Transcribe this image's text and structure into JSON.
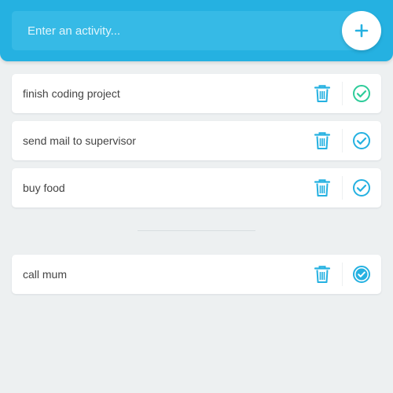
{
  "header": {
    "input": {
      "placeholder": "Enter an activity...",
      "value": ""
    },
    "add_button_icon": "plus-icon"
  },
  "todo_list": [
    {
      "text": "finish coding project",
      "status": "pending",
      "check_color": "#2ecc9a"
    },
    {
      "text": "send mail to supervisor",
      "status": "pending",
      "check_color": "#25b1e1"
    },
    {
      "text": "buy food",
      "status": "pending",
      "check_color": "#25b1e1"
    }
  ],
  "completed_list": [
    {
      "text": "call mum",
      "status": "completed",
      "check_color": "#25b1e1"
    }
  ],
  "colors": {
    "accent": "#25b1e1",
    "header_bg": "#25b1e1",
    "input_bg": "#36bae6",
    "page_bg": "#edf0f1",
    "hover_check": "#2ecc9a",
    "text": "#444444"
  },
  "icons": {
    "delete": "trash-icon",
    "complete": "check-circle-icon",
    "completed": "check-circle-filled-icon"
  }
}
